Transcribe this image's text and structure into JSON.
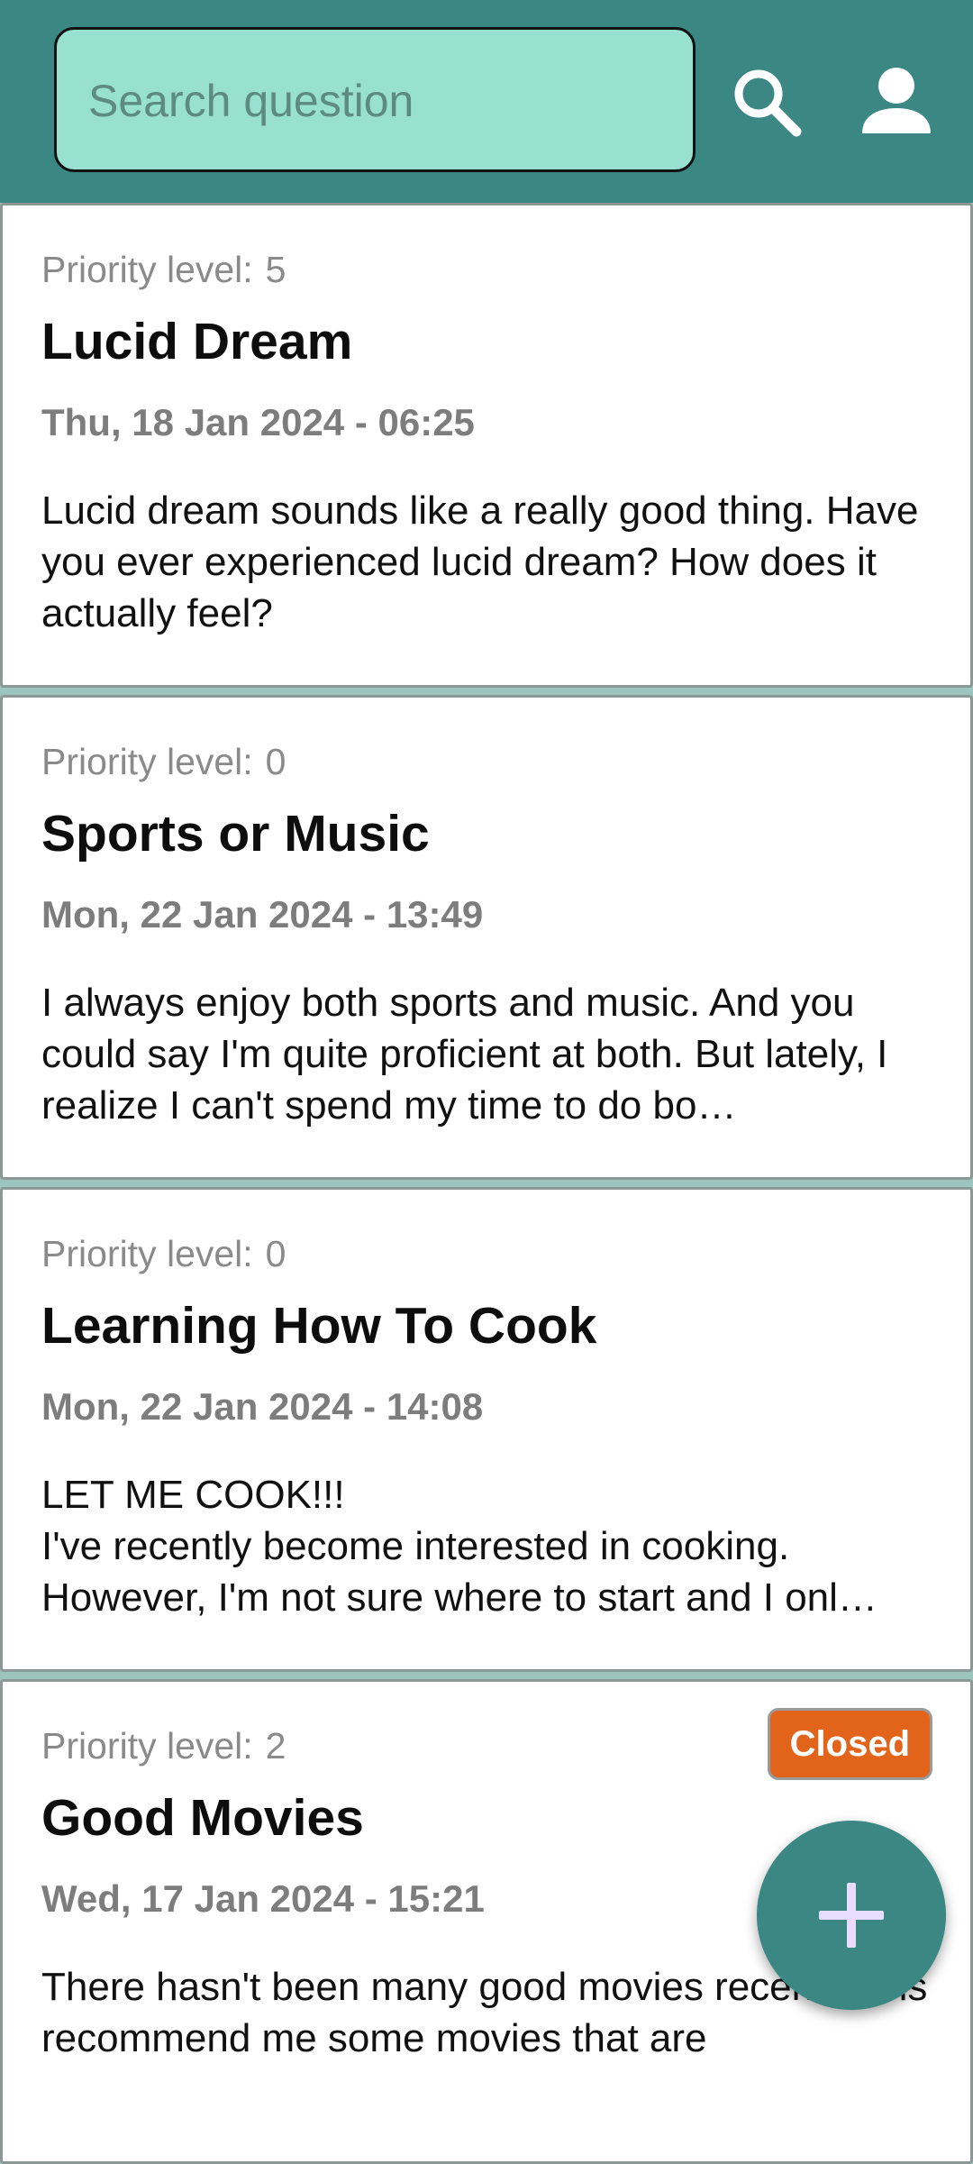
{
  "search": {
    "placeholder": "Search question",
    "value": ""
  },
  "header": {
    "search_icon": "search-icon",
    "account_icon": "account-icon",
    "background": "#3a8783"
  },
  "questions": [
    {
      "priority_label": "Priority level:",
      "priority": "5",
      "title": "Lucid Dream",
      "date": "Thu, 18 Jan 2024 - 06:25",
      "body": "Lucid dream sounds like a really good thing. Have you ever experienced lucid dream? How does it actually feel?",
      "status": ""
    },
    {
      "priority_label": "Priority level:",
      "priority": "0",
      "title": "Sports or Music",
      "date": "Mon, 22 Jan 2024 - 13:49",
      "body": "I always enjoy both sports and music. And you could say I'm quite proficient at both. But lately, I realize I can't spend my time to do bo…",
      "status": ""
    },
    {
      "priority_label": "Priority level:",
      "priority": "0",
      "title": "Learning How To Cook",
      "date": "Mon, 22 Jan 2024 - 14:08",
      "body": "LET ME COOK!!!\nI've recently become interested in cooking. However, I'm not sure where to start and I onl…",
      "status": ""
    },
    {
      "priority_label": "Priority level:",
      "priority": "2",
      "title": "Good Movies",
      "date": "Wed, 17 Jan 2024 - 15:21",
      "body": "There hasn't been many good movies recently. Pls recommend me some movies that are",
      "status": "Closed"
    }
  ],
  "fab": {
    "icon": "plus-icon",
    "color": "#3a8783"
  },
  "colors": {
    "search_fill": "#98e0d0",
    "closed_badge": "#e2631a",
    "list_background": "#9cc5bd"
  }
}
